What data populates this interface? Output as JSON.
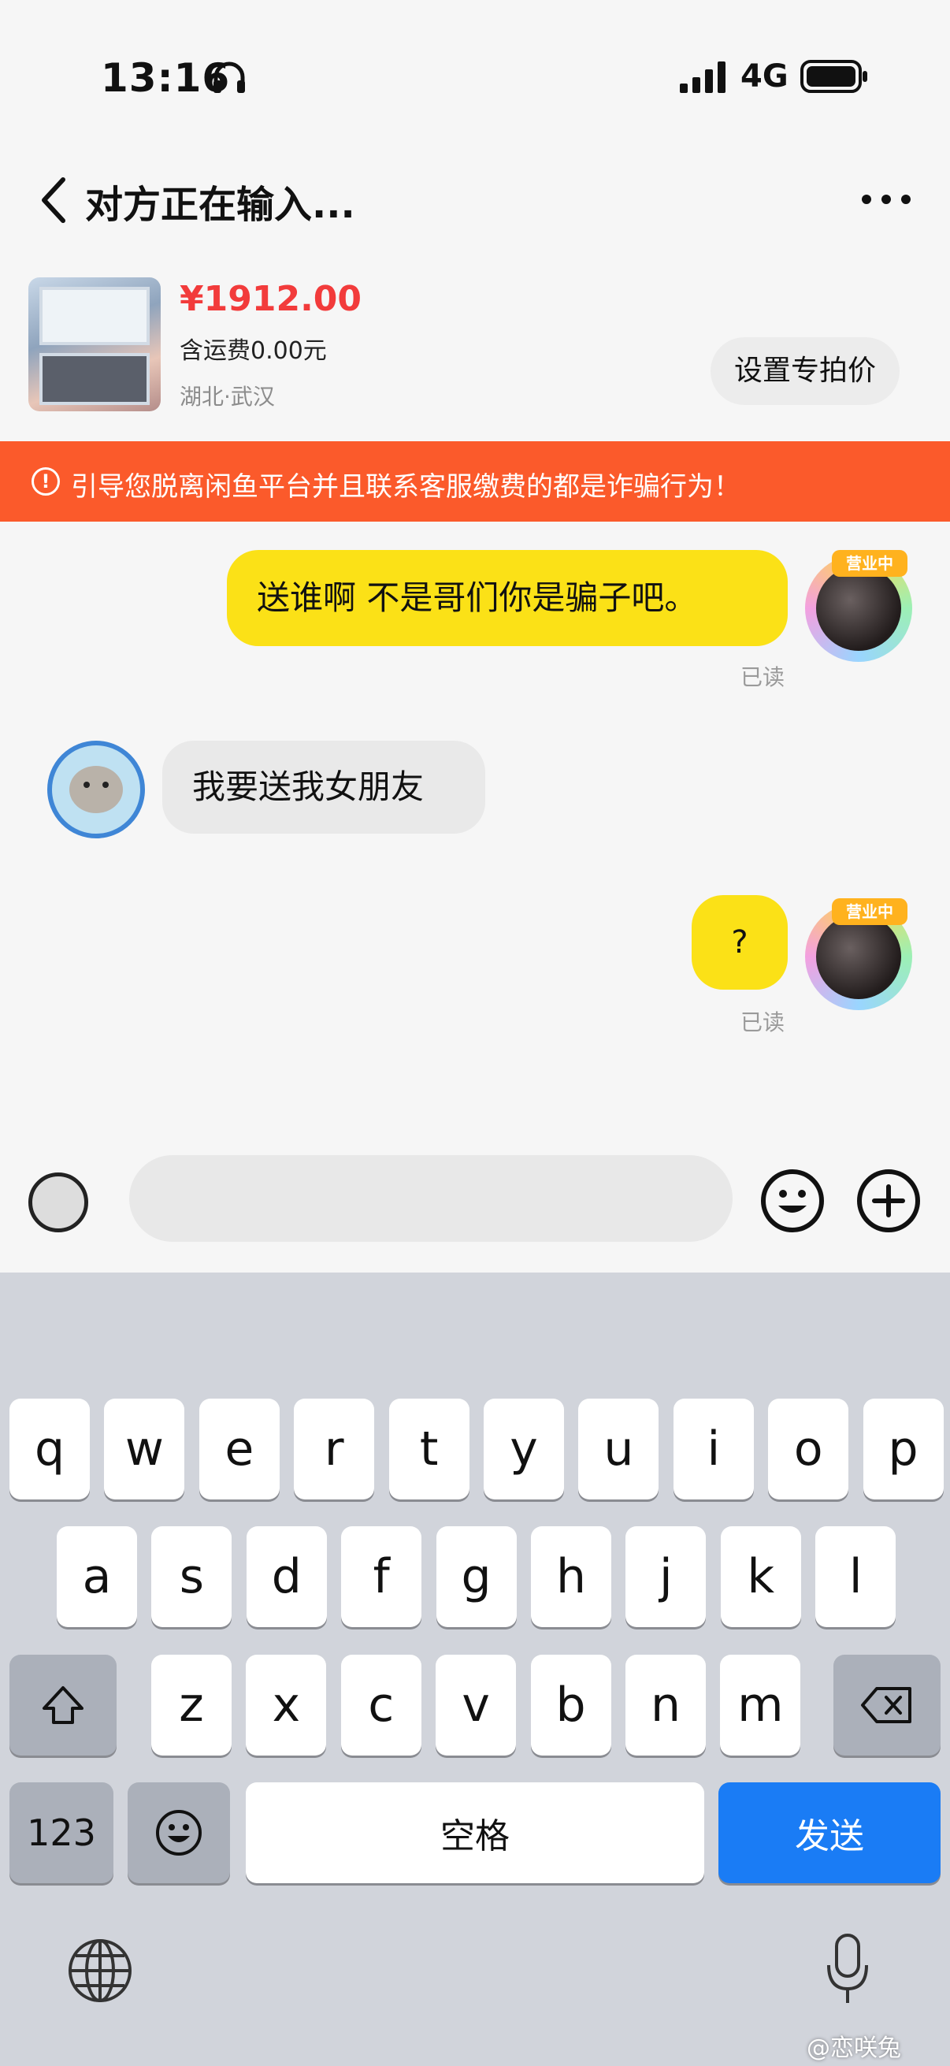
{
  "status_bar": {
    "time": "13:16",
    "network": "4G"
  },
  "header": {
    "title": "对方正在输入..."
  },
  "product": {
    "price": "¥1912.00",
    "shipping": "含运费0.00元",
    "location": "湖北·武汉",
    "set_price_label": "设置专拍价"
  },
  "warning": {
    "text": "引导您脱离闲鱼平台并且联系客服缴费的都是诈骗行为！"
  },
  "messages": [
    {
      "direction": "out",
      "text": "送谁啊 不是哥们你是骗子吧。",
      "status": "已读",
      "badge": "营业中"
    },
    {
      "direction": "in",
      "text": "我要送我女朋友"
    },
    {
      "direction": "out",
      "text": "?",
      "status": "已读",
      "badge": "营业中"
    }
  ],
  "input": {
    "value": ""
  },
  "keyboard": {
    "row1": [
      "q",
      "w",
      "e",
      "r",
      "t",
      "y",
      "u",
      "i",
      "o",
      "p"
    ],
    "row2": [
      "a",
      "s",
      "d",
      "f",
      "g",
      "h",
      "j",
      "k",
      "l"
    ],
    "row3": [
      "z",
      "x",
      "c",
      "v",
      "b",
      "n",
      "m"
    ],
    "numbers_label": "123",
    "space_label": "空格",
    "send_label": "发送"
  },
  "watermark": "@恋咲兔",
  "colors": {
    "accent_yellow": "#fbe117",
    "price_red": "#f23b3b",
    "warning_orange": "#fb5a2b",
    "send_blue": "#1a7cf5"
  }
}
